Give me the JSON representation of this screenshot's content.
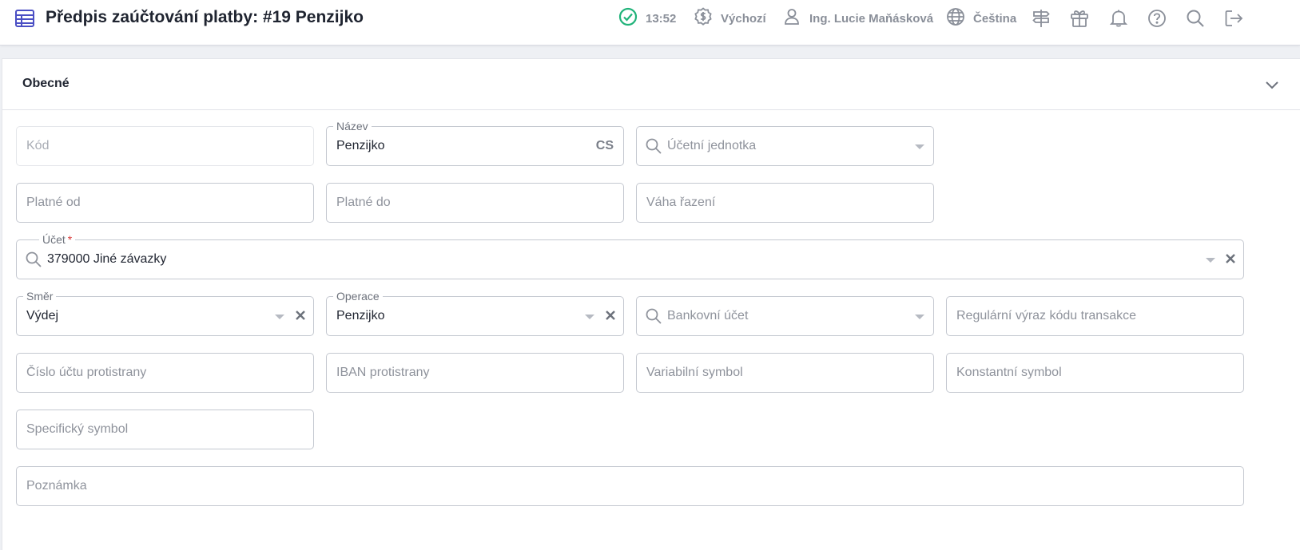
{
  "header": {
    "title": "Předpis zaúčtování platby: #19 Penzijko",
    "time": "13:52",
    "currency_label": "Výchozí",
    "user_name": "Ing. Lucie Maňásková",
    "language": "Čeština"
  },
  "section": {
    "title": "Obecné"
  },
  "form": {
    "kod": {
      "placeholder": "Kód"
    },
    "nazev": {
      "label": "Název",
      "value": "Penzijko",
      "suffix": "CS"
    },
    "ucetni_jednotka": {
      "placeholder": "Účetní jednotka"
    },
    "platne_od": {
      "placeholder": "Platné od"
    },
    "platne_do": {
      "placeholder": "Platné do"
    },
    "vaha_razeni": {
      "placeholder": "Váha řazení"
    },
    "ucet": {
      "label": "Účet",
      "required_mark": "*",
      "value": "379000 Jiné závazky"
    },
    "smer": {
      "label": "Směr",
      "value": "Výdej"
    },
    "operace": {
      "label": "Operace",
      "value": "Penzijko"
    },
    "bankovni_ucet": {
      "placeholder": "Bankovní účet"
    },
    "regularni_vyraz": {
      "placeholder": "Regulární výraz kódu transakce"
    },
    "cislo_uctu": {
      "placeholder": "Číslo účtu protistrany"
    },
    "iban": {
      "placeholder": "IBAN protistrany"
    },
    "variabilni_symbol": {
      "placeholder": "Variabilní symbol"
    },
    "konstantni_symbol": {
      "placeholder": "Konstantní symbol"
    },
    "specificky_symbol": {
      "placeholder": "Specifický symbol"
    },
    "poznamka": {
      "placeholder": "Poznámka"
    }
  },
  "colors": {
    "accent": "#4b4fc4",
    "status_ok": "#21b37a",
    "icon_gray": "#8a8f99",
    "required": "#d93a3a"
  },
  "icons": {
    "title": "table-icon",
    "status": "check-circle-icon",
    "currency": "dollar-badge-icon",
    "user": "user-icon",
    "language": "globe-icon",
    "toolbar": [
      "signpost-icon",
      "gift-icon",
      "bell-icon",
      "help-icon",
      "search-icon",
      "logout-icon"
    ],
    "section_toggle": "chevron-down-icon"
  }
}
